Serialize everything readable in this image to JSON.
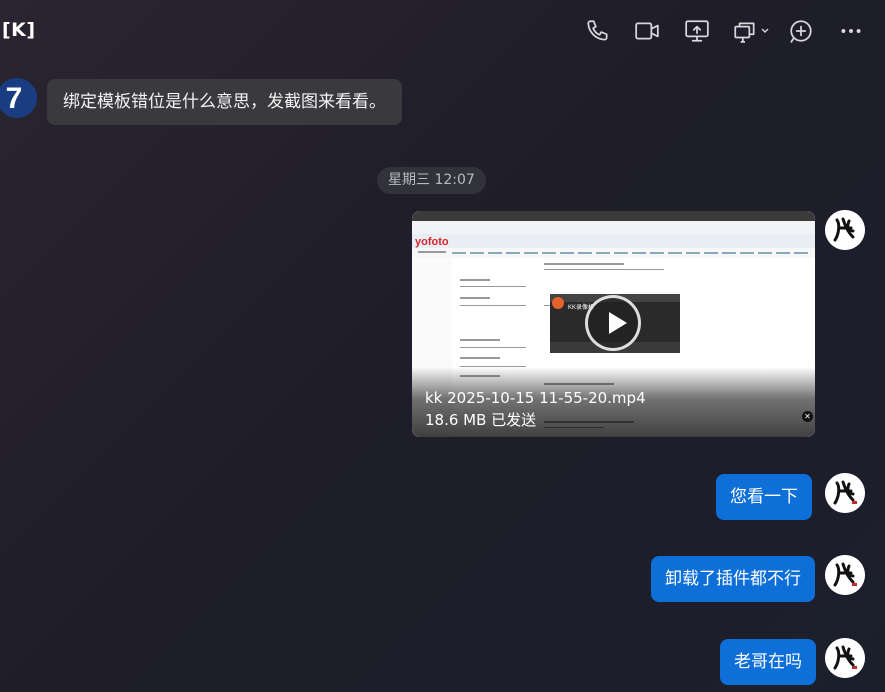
{
  "header": {
    "title": "[K]",
    "tools": [
      "phone-icon",
      "video-call-icon",
      "screen-share-icon",
      "multi-window-icon",
      "add-icon",
      "more-icon"
    ]
  },
  "messages": {
    "incoming_text": "绑定模板错位是什么意思，发截图来看看。",
    "incoming_avatar_text": "7",
    "time_separator": "星期三 12:07",
    "video": {
      "filename": "kk 2025-10-15 11-55-20.mp4",
      "status": "18.6 MB 已发送",
      "thumb_logo": "yofoto",
      "thumb_app": "KK录像机"
    },
    "outgoing": [
      "您看一下",
      "卸载了插件都不行",
      "老哥在吗"
    ]
  },
  "colors": {
    "outgoing_bubble": "#0f6fd8",
    "incoming_bubble": "#3a3a3e",
    "background": "#1f1d2a"
  }
}
